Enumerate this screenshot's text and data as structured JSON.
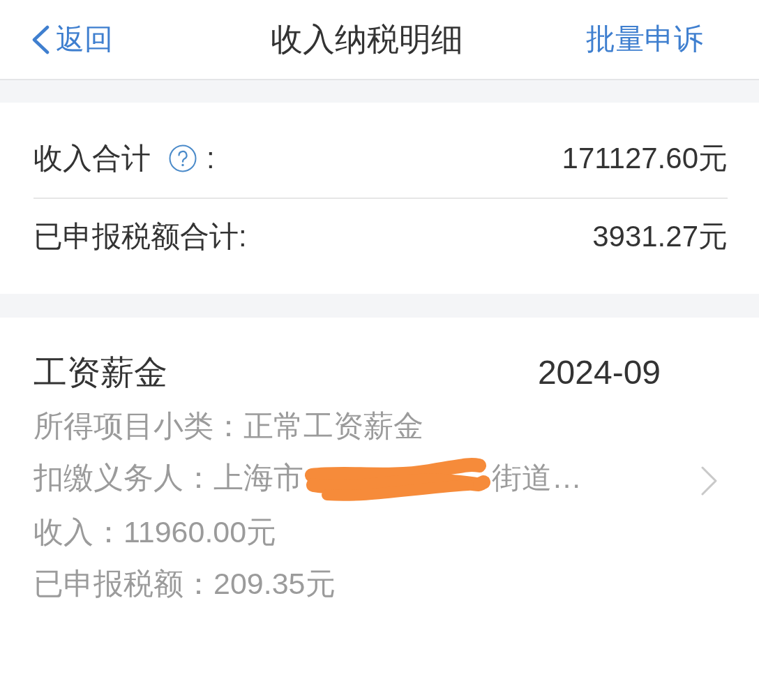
{
  "nav": {
    "back_label": "返回",
    "title": "收入纳税明细",
    "action_label": "批量申诉"
  },
  "summary": [
    {
      "label": "收入合计",
      "help": true,
      "suffix": ":",
      "value": "171127.60元"
    },
    {
      "label": "已申报税额合计:",
      "help": false,
      "value": "3931.27元"
    }
  ],
  "records": [
    {
      "category": "工资薪金",
      "period": "2024-09",
      "details": [
        {
          "text": "所得项目小类：正常工资薪金",
          "redacted": false
        },
        {
          "text": "扣缴义务人：上海市",
          "redacted": true,
          "text_after": "街道…"
        },
        {
          "text": "收入：11960.00元",
          "redacted": false
        },
        {
          "text": "已申报税额：209.35元",
          "redacted": false
        }
      ]
    }
  ]
}
